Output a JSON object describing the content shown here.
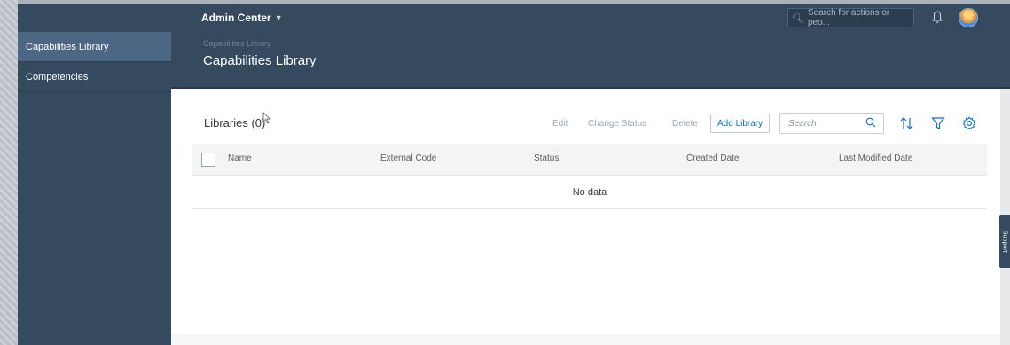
{
  "shell": {
    "title": "Admin Center",
    "search_placeholder": "Search for actions or peo..."
  },
  "sidebar": {
    "items": [
      {
        "label": "Capabilities Library",
        "active": true
      },
      {
        "label": "Competencies",
        "active": false
      }
    ]
  },
  "page": {
    "breadcrumb": "Capabilities Library",
    "title": "Capabilities Library"
  },
  "toolbar": {
    "title": "Libraries (0)",
    "edit_label": "Edit",
    "change_status_label": "Change Status",
    "delete_label": "Delete",
    "add_label": "Add Library",
    "search_placeholder": "Search"
  },
  "table": {
    "columns": [
      "Name",
      "External Code",
      "Status",
      "Created Date",
      "Last Modified Date"
    ],
    "empty_text": "No data"
  },
  "support": {
    "label": "Support"
  },
  "colors": {
    "shell": "#354a5f",
    "accent": "#0a6ed1",
    "active_nav": "#4b6784"
  },
  "icons": [
    "search-icon",
    "bell-icon",
    "sort-icon",
    "filter-icon",
    "settings-icon",
    "cursor-icon"
  ]
}
